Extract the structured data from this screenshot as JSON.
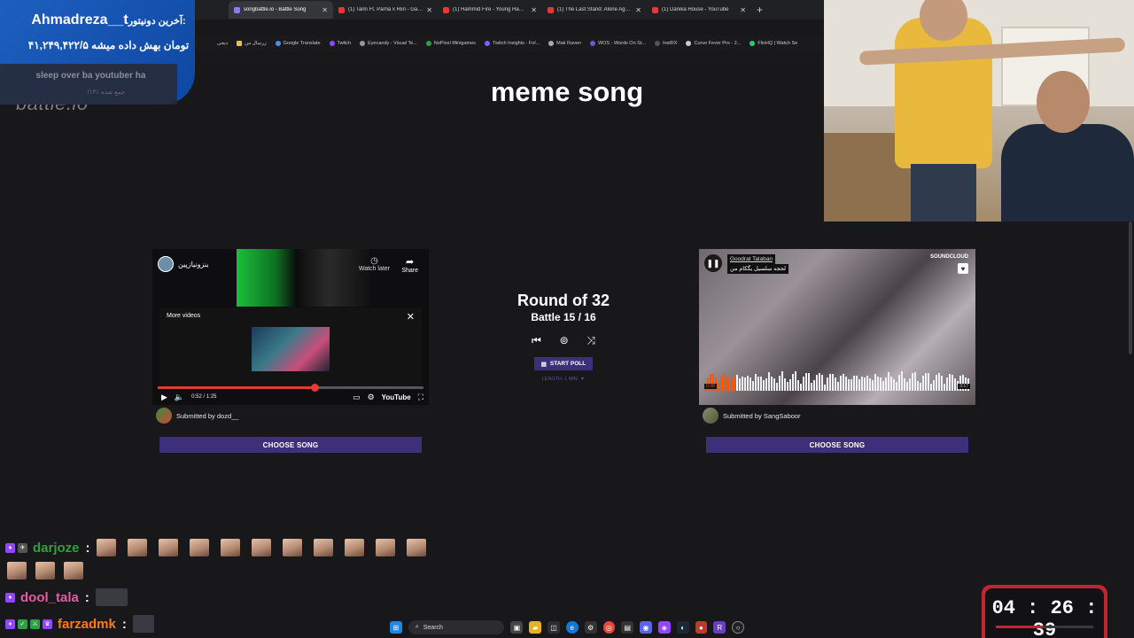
{
  "browser": {
    "tabs": [
      {
        "label": "songbattle.io - Battle Song"
      },
      {
        "label": "(1) Tarin Ft. Parna x Riiri - Gangs"
      },
      {
        "label": "(1) Hammid Fire - Young Hamm"
      },
      {
        "label": "(1) The Last Stand: Alone Against A"
      },
      {
        "label": "(1) Danika House - YouTube"
      }
    ],
    "new_tab_glyph": "+",
    "bookmarks": [
      {
        "label": "دیجی"
      },
      {
        "label": "زرنیبال من"
      },
      {
        "label": "Google Translate"
      },
      {
        "label": "Twitch"
      },
      {
        "label": "Eyecandy - Visual Te..."
      },
      {
        "label": "NoPixel Minigames"
      },
      {
        "label": "Twitch Insights - Fol..."
      },
      {
        "label": "Mak Raven"
      },
      {
        "label": "WOS - Words On St..."
      },
      {
        "label": "InstRX"
      },
      {
        "label": "Curve Fever Pro - 2..."
      },
      {
        "label": "FlixHQ | Watch Se"
      }
    ]
  },
  "donation": {
    "prefix": "آخرین دونیتور:",
    "donor": "Ahmadreza__t",
    "amount_text": "۴۱,۲۴۹,۴۲۲/۵ تومان بهش داده میشه",
    "message": "sleep over ba youtuber ha",
    "subtext": "/۱۳٪ جمع شده"
  },
  "site": {
    "logo_partial": "battle.io",
    "page_title": "meme song"
  },
  "left_song": {
    "channel_name": "بنزونیازپین",
    "watch_later": "Watch later",
    "share": "Share",
    "more_videos": "More videos",
    "time": "0:52 / 1:25",
    "platform": "YouTube",
    "progress_percent": 59,
    "submitted_by": "Submitted by dozd__",
    "choose_label": "CHOOSE SONG"
  },
  "right_song": {
    "artist": "Goodrat Talaban",
    "track": "لحجه سلسیل یگکام من",
    "platform": "SOUNDCLOUD",
    "time_left": "0:30",
    "time_right": "3:17",
    "submitted_by": "Submitted by SangSaboor",
    "choose_label": "CHOOSE SONG"
  },
  "battle": {
    "round_label": "Round of 32",
    "battle_label": "Battle 15 / 16",
    "start_poll_label": "START POLL",
    "length_label": "LENGTH: 1 MIN. ▼"
  },
  "chat": [
    {
      "name": "darjoze",
      "color": "#2ea043"
    },
    {
      "name": "dool_tala",
      "color": "#e75aa6"
    },
    {
      "name": "farzadmk",
      "color": "#ff7a1a"
    }
  ],
  "timer": {
    "display": "04 : 26 : 39",
    "progress_fraction": 0.48
  },
  "taskbar": {
    "search_label": "Search"
  },
  "colors": {
    "page_bg": "#18181b",
    "accent_button": "#3d2f7a",
    "donation_blue": "#1e5fbf",
    "timer_red": "#c0262f"
  }
}
